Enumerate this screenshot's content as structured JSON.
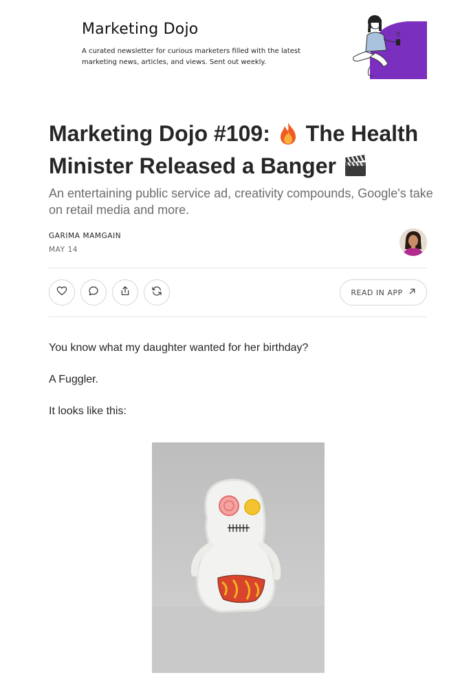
{
  "publication": {
    "name": "Marketing Dojo",
    "description": "A curated newsletter for curious marketers filled with the latest marketing news, articles, and views.  Sent out weekly."
  },
  "post": {
    "title_part1": "Marketing Dojo #109:",
    "title_part2": "The Health Minister Released a Banger",
    "subtitle": "An entertaining public service ad, creativity compounds, Google's take on retail media and more.",
    "author": "GARIMA MAMGAIN",
    "date": "MAY 14"
  },
  "actions": {
    "read_in_app": "READ IN APP"
  },
  "body": {
    "p1": "You know what my daughter wanted for her birthday?",
    "p2": "A Fuggler.",
    "p3": "It looks like this:"
  },
  "icons": {
    "title_emoji_1": "fire-icon",
    "title_emoji_2": "clapperboard-icon",
    "like": "heart-icon",
    "comment": "comment-icon",
    "share": "share-icon",
    "restack": "restack-icon",
    "external": "arrow-up-right-icon"
  },
  "colors": {
    "accent_purple": "#7b2fbf",
    "title": "#262626",
    "subtitle": "#6b6b6b"
  }
}
